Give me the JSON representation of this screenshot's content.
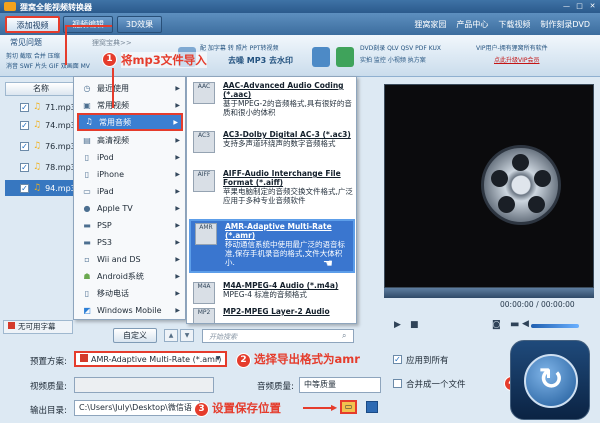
{
  "window": {
    "title": "狸窝全能视频转换器",
    "buttons": [
      "—",
      "□",
      "✕"
    ]
  },
  "toptabs": [
    "添加视频",
    "视频编辑",
    "3D效果"
  ],
  "toplinks": [
    "狸窝家园",
    "产品中心",
    "下载视频",
    "制作刻录DVD"
  ],
  "feature_tabs": [
    "常见问题",
    "狸窝宝典>>"
  ],
  "features": {
    "left_lines": [
      "剪切 截取 合并 压缩",
      "消音 SWF 片头 GIF 双画面 MV"
    ],
    "mid_lines": [
      "配 加字幕 转 照片 PPT转视频",
      "去噪 MP3 去水印"
    ],
    "dvd_lines": [
      "DVD刻录 QLV QSV PDF KUX",
      "实拍 监控 小视频 执方案"
    ],
    "vip_text": "VIP用户-拥有狸窝所有软件",
    "vip_link": "点此升级VIP会员"
  },
  "filelist": {
    "header": "名称",
    "files": [
      "71.mp3",
      "74.mp3",
      "76.mp3",
      "78.mp3",
      "94.mp3"
    ],
    "no_subtitle": "无可用字幕"
  },
  "menu1": [
    {
      "label": "最近使用",
      "icon": "◷"
    },
    {
      "label": "常用视频",
      "icon": "▣"
    },
    {
      "label": "常用音频",
      "icon": "♫"
    },
    {
      "label": "高清视频",
      "icon": "▤"
    },
    {
      "label": "iPod",
      "icon": "▯"
    },
    {
      "label": "iPhone",
      "icon": "▯"
    },
    {
      "label": "iPad",
      "icon": "▭"
    },
    {
      "label": "Apple TV",
      "icon": ""
    },
    {
      "label": "PSP",
      "icon": "▬"
    },
    {
      "label": "PS3",
      "icon": "▬"
    },
    {
      "label": "Wii and DS",
      "icon": "▫"
    },
    {
      "label": "Android系统",
      "icon": "☗"
    },
    {
      "label": "移动电话",
      "icon": "▯"
    },
    {
      "label": "Windows Mobile",
      "icon": "◩"
    }
  ],
  "menu2": [
    {
      "name": "AAC-Advanced Audio Coding (*.aac)",
      "desc": "基于MPEG-2的音频格式,具有很好的音质和很小的体积",
      "icon": "AAC"
    },
    {
      "name": "AC3-Dolby Digital AC-3 (*.ac3)",
      "desc": "支持多声道环绕声的数字音频格式",
      "icon": "AC3"
    },
    {
      "name": "AIFF-Audio Interchange File Format (*.aiff)",
      "desc": "苹果电脑制定的音频交换文件格式,广泛应用于多种专业音频软件",
      "icon": "AIFF"
    },
    {
      "name": "AMR-Adaptive Multi-Rate (*.amr)",
      "desc": "移动通信系统中使用最广泛的语音标准,保存手机录音的格式,文件大体积小.",
      "icon": "AMR"
    },
    {
      "name": "M4A-MPEG-4 Audio (*.m4a)",
      "desc": "MPEG-4 标准的音频格式",
      "icon": "M4A"
    },
    {
      "name": "MP2-MPEG Layer-2 Audio",
      "desc": "",
      "icon": "MP2"
    }
  ],
  "menu_bottom": {
    "customize": "自定义",
    "up": "▲",
    "down": "▼",
    "search_placeholder": "开始搜索"
  },
  "preview": {
    "time": "00:00:00 / 00:00:00"
  },
  "bottom": {
    "preset_label": "预置方案:",
    "preset_value": "AMR-Adaptive Multi-Rate (*.amr)",
    "video_quality_label": "视频质量:",
    "audio_quality_label": "音频质量:",
    "audio_quality_value": "中等质量",
    "output_label": "输出目录:",
    "output_value": "C:\\Users\\July\\Desktop\\微信语",
    "apply_all": "应用到所有",
    "merge": "合并成一个文件"
  },
  "annotations": {
    "a1": "将mp3文件导入",
    "a2": "选择导出格式为amr",
    "a3": "设置保存位置",
    "n1": "1",
    "n2": "2",
    "n3": "3",
    "n4": "4"
  },
  "colors": {
    "accent": "#e53c2c",
    "selection": "#3777c0"
  }
}
